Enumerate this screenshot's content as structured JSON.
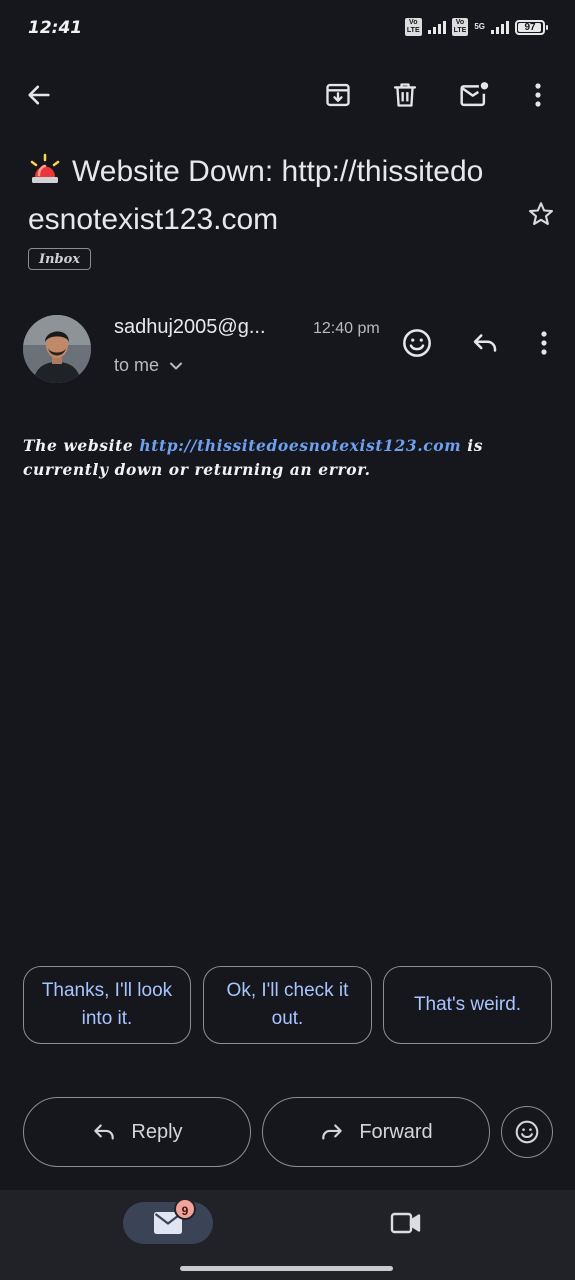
{
  "status_bar": {
    "time": "12:41",
    "sim1_tag": "VoLTE",
    "sim2_tag": "VoLTE",
    "network_type": "5G",
    "battery_percent": "97",
    "battery_level": 0.97
  },
  "toolbar": {
    "back_icon": "arrow-left-icon",
    "archive_icon": "archive-icon",
    "delete_icon": "trash-icon",
    "mark_unread_icon": "mail-unread-icon",
    "more_icon": "more-vert-icon"
  },
  "subject": {
    "emoji": "🚨",
    "text": "Website Down: http://thissitedoesnotexist123.com",
    "label": "Inbox"
  },
  "message": {
    "sender": "sadhuj2005@g...",
    "time": "12:40 pm",
    "recipient": "to me",
    "body_prefix": "The website ",
    "body_link": "http://thissitedoesnotexist123.com",
    "body_suffix": " is currently down or returning an error."
  },
  "smart_replies": [
    "Thanks, I'll look into it.",
    "Ok, I'll check it out.",
    "That's weird."
  ],
  "actions": {
    "reply_label": "Reply",
    "forward_label": "Forward"
  },
  "bottom_nav": {
    "mail_badge": "9"
  },
  "colors": {
    "background": "#16171c",
    "link": "#6ea0f2",
    "smart_reply_text": "#a8c4ff",
    "badge": "#f1a39b",
    "mail_tab_active": "#3a4456"
  }
}
